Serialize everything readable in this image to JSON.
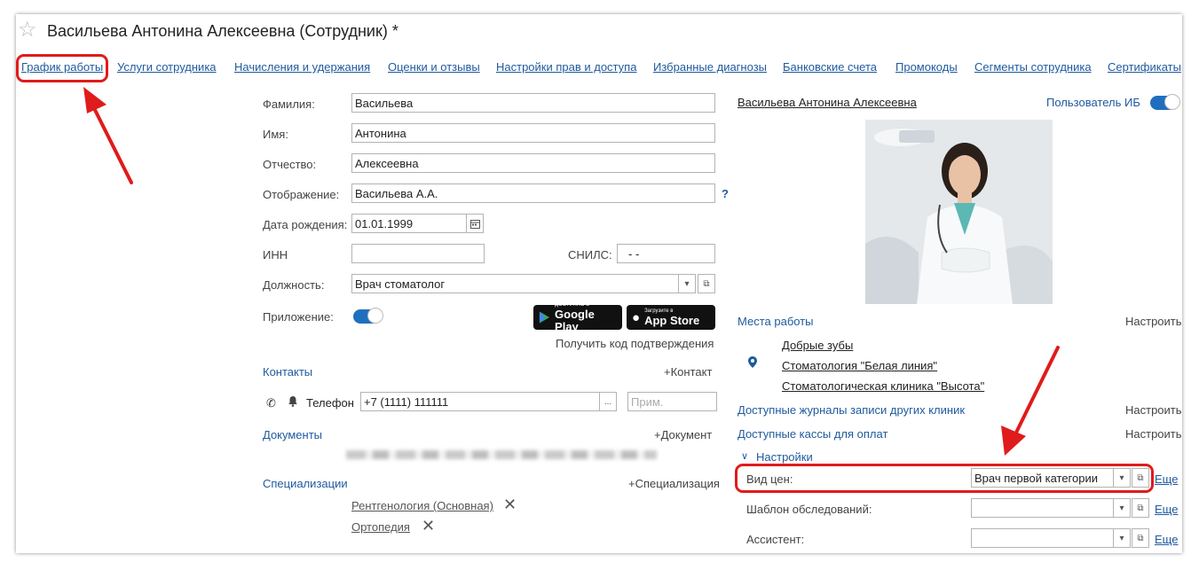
{
  "window": {
    "title": "Васильева Антонина Алексеевна (Сотрудник) *"
  },
  "tabs": [
    {
      "label": "График работы"
    },
    {
      "label": "Услуги сотрудника"
    },
    {
      "label": "Начисления и удержания"
    },
    {
      "label": "Оценки и отзывы"
    },
    {
      "label": "Настройки прав и доступа"
    },
    {
      "label": "Избранные диагнозы"
    },
    {
      "label": "Банковские счета"
    },
    {
      "label": "Промокоды"
    },
    {
      "label": "Сегменты сотрудника"
    },
    {
      "label": "Сертификаты"
    }
  ],
  "form": {
    "last_name": {
      "label": "Фамилия:",
      "value": "Васильева"
    },
    "first_name": {
      "label": "Имя:",
      "value": "Антонина"
    },
    "patronymic": {
      "label": "Отчество:",
      "value": "Алексеевна"
    },
    "display": {
      "label": "Отображение:",
      "value": "Васильева А.А.",
      "help": "?"
    },
    "birth_date": {
      "label": "Дата рождения:",
      "value": "01.01.1999"
    },
    "inn": {
      "label": "ИНН",
      "value": ""
    },
    "snils": {
      "label": "СНИЛС:",
      "value": "-   -"
    },
    "position": {
      "label": "Должность:",
      "value": "Врач стоматолог"
    },
    "app": {
      "label": "Приложение:",
      "enabled": true
    },
    "google_play": {
      "small": "ДОСТУПНО В",
      "big": "Google Play"
    },
    "app_store": {
      "small": "Загрузите в",
      "big": "App Store"
    },
    "get_code": "Получить код подтверждения"
  },
  "contacts": {
    "title": "Контакты",
    "add": "+Контакт",
    "phone_label": "Телефон",
    "phone_value": "+7 (1111) 111111",
    "note_placeholder": "Прим.",
    "ellipsis": "..."
  },
  "documents": {
    "title": "Документы",
    "add": "+Документ"
  },
  "specializations": {
    "title": "Специализации",
    "add": "+Специализация",
    "items": [
      {
        "label": "Рентгенология (Основная)"
      },
      {
        "label": "Ортопедия"
      }
    ]
  },
  "right": {
    "employee_name": "Васильева Антонина Алексеевна",
    "ib_user": {
      "label": "Пользователь ИБ",
      "enabled": true
    },
    "workplaces": {
      "title": "Места работы",
      "configure": "Настроить",
      "items": [
        "Добрые зубы",
        "Стоматология \"Белая линия\"",
        "Стоматологическая клиника \"Высота\""
      ]
    },
    "journals": {
      "title": "Доступные журналы записи других клиник",
      "configure": "Настроить"
    },
    "cash": {
      "title": "Доступные кассы для оплат",
      "configure": "Настроить"
    },
    "settings": {
      "title": "Настройки",
      "price_type": {
        "label": "Вид цен:",
        "value": "Врач первой категории",
        "more": "Еще"
      },
      "exam_template": {
        "label": "Шаблон обследований:",
        "value": "",
        "more": "Еще"
      },
      "assistant": {
        "label": "Ассистент:",
        "value": "",
        "more": "Еще"
      }
    }
  },
  "colors": {
    "accent": "#1f5a9e",
    "highlight": "#e01b1b",
    "toggle": "#1f6fbf"
  }
}
